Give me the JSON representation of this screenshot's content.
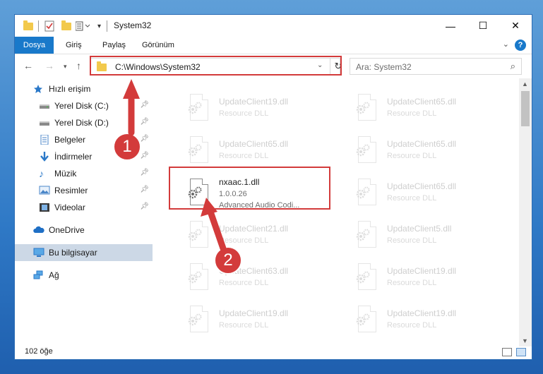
{
  "window": {
    "title": "System32",
    "controls": {
      "minimize": "—",
      "maximize": "☐",
      "close": "✕"
    }
  },
  "ribbon": {
    "tabs": [
      "Dosya",
      "Giriş",
      "Paylaş",
      "Görünüm"
    ],
    "help_icon": "?"
  },
  "navigation": {
    "address_path": "C:\\Windows\\System32",
    "search_placeholder": "Ara: System32"
  },
  "sidebar": {
    "quick_access_label": "Hızlı erişim",
    "items": [
      {
        "label": "Yerel Disk (C:)",
        "icon": "drive-icon",
        "pinned": true
      },
      {
        "label": "Yerel Disk (D:)",
        "icon": "drive-icon",
        "pinned": true
      },
      {
        "label": "Belgeler",
        "icon": "documents-icon",
        "pinned": true
      },
      {
        "label": "İndirmeler",
        "icon": "download-icon",
        "pinned": true
      },
      {
        "label": "Müzik",
        "icon": "music-icon",
        "pinned": true
      },
      {
        "label": "Resimler",
        "icon": "pictures-icon",
        "pinned": true
      },
      {
        "label": "Videolar",
        "icon": "videos-icon",
        "pinned": true
      }
    ],
    "onedrive": "OneDrive",
    "this_pc": "Bu bilgisayar",
    "network": "Ağ"
  },
  "files": {
    "left_column": [
      {
        "name": "UpdateClient19.dll",
        "type": "Resource DLL"
      },
      {
        "name": "UpdateClient65.dll",
        "type": "Resource DLL"
      },
      {
        "name": "UpdateClient21.dll",
        "type": "Resource DLL"
      },
      {
        "name": "UpdateClient63.dll",
        "type": "Resource DLL"
      },
      {
        "name": "UpdateClient19.dll",
        "type": "Resource DLL"
      }
    ],
    "right_column": [
      {
        "name": "UpdateClient65.dll",
        "type": "Resource DLL"
      },
      {
        "name": "UpdateClient65.dll",
        "type": "Resource DLL"
      },
      {
        "name": "UpdateClient65.dll",
        "type": "Resource DLL"
      },
      {
        "name": "UpdateClient5.dll",
        "type": "Resource DLL"
      },
      {
        "name": "UpdateClient19.dll",
        "type": "Resource DLL"
      },
      {
        "name": "UpdateClient19.dll",
        "type": "Resource DLL"
      }
    ],
    "highlighted": {
      "name": "nxaac.1.dll",
      "version": "1.0.0.26",
      "description": "Advanced Audio Codi..."
    }
  },
  "status": {
    "item_count": "102 öğe"
  },
  "annotations": {
    "step1": "1",
    "step2": "2"
  },
  "colors": {
    "accent": "#1979ca",
    "annotation_red": "#d33b3b",
    "folder_yellow": "#f2c94c"
  }
}
